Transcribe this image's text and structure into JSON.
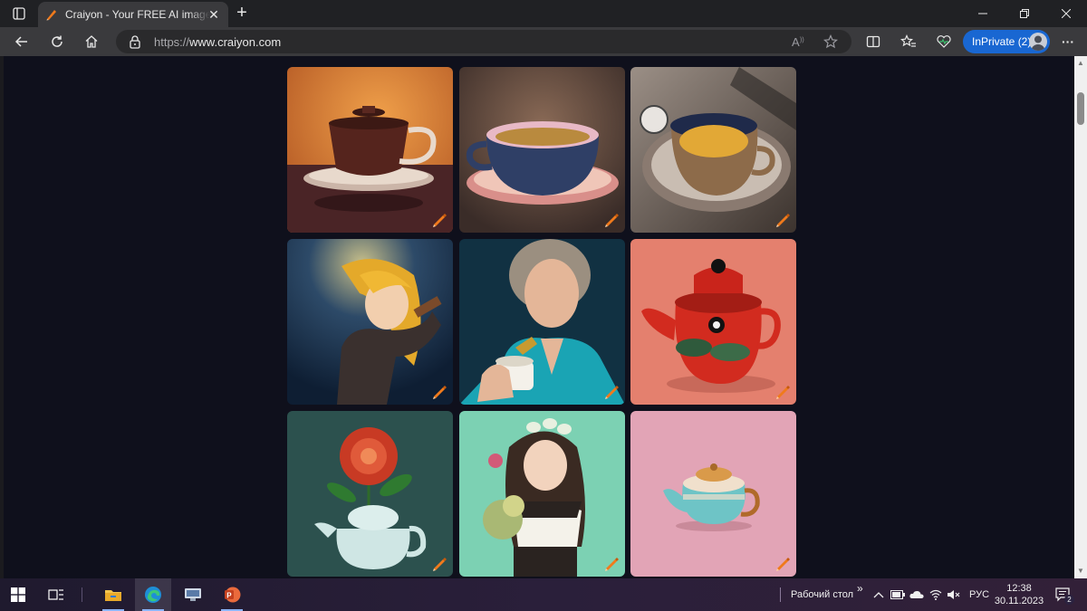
{
  "browser": {
    "tab_title": "Craiyon - Your FREE AI image generator",
    "tab_close": "✕",
    "new_tab": "+",
    "url_scheme": "https://",
    "url_host": "www.craiyon.com",
    "inprivate_label": "InPrivate (2)",
    "more_label": "···"
  },
  "gallery": {
    "items": [
      {
        "subject": "teacup-on-saucer-orange",
        "bg": "#d88a3c"
      },
      {
        "subject": "teacup-on-saucer-blue",
        "bg": "#5b4a40"
      },
      {
        "subject": "teacup-on-saucer-silver",
        "bg": "#6a5e55"
      },
      {
        "subject": "anime-girl-yellow-hair",
        "bg": "#1d3350"
      },
      {
        "subject": "woman-holding-cup",
        "bg": "#123040"
      },
      {
        "subject": "red-teapot-with-leaves",
        "bg": "#e57f6d"
      },
      {
        "subject": "teapot-vase-with-flower",
        "bg": "#2c514e"
      },
      {
        "subject": "anime-girl-with-flowers",
        "bg": "#7cd1b3"
      },
      {
        "subject": "teal-teapot-on-pink",
        "bg": "#e2a4b6"
      }
    ]
  },
  "taskbar": {
    "desktop_label": "Рабочий стол",
    "chevron": "»",
    "lang": "РУС",
    "time": "12:38",
    "date": "30.11.2023",
    "notification_count": "2"
  },
  "colors": {
    "accent": "#1967d2",
    "page_bg": "#0f101c",
    "edit_icon": "#f07a1c"
  }
}
